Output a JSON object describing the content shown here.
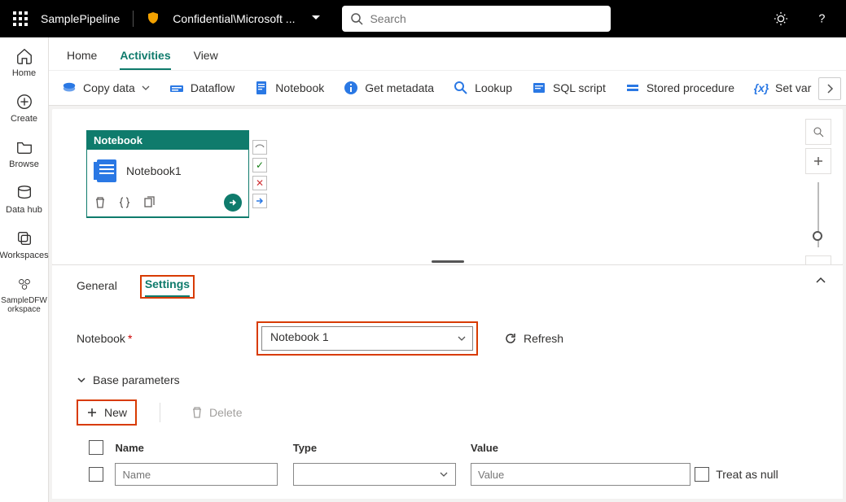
{
  "topbar": {
    "pipeline_name": "SamplePipeline",
    "sensitivity_prefix": "Confidential\\Microsoft ...",
    "search_placeholder": "Search"
  },
  "rail": {
    "home": "Home",
    "create": "Create",
    "browse": "Browse",
    "datahub": "Data hub",
    "workspaces": "Workspaces",
    "current_workspace": "SampleDFW\norkspace"
  },
  "main_tabs": {
    "home": "Home",
    "activities": "Activities",
    "view": "View"
  },
  "activities_toolbar": {
    "copy_data": "Copy data",
    "dataflow": "Dataflow",
    "notebook": "Notebook",
    "get_metadata": "Get metadata",
    "lookup": "Lookup",
    "sql_script": "SQL script",
    "stored_procedure": "Stored procedure",
    "set_var": "Set var"
  },
  "canvas": {
    "activity_type": "Notebook",
    "activity_name": "Notebook1"
  },
  "panel_tabs": {
    "general": "General",
    "settings": "Settings"
  },
  "settings": {
    "notebook_label": "Notebook",
    "notebook_value": "Notebook 1",
    "refresh": "Refresh",
    "base_parameters": "Base parameters",
    "new_btn": "New",
    "delete_btn": "Delete",
    "grid": {
      "headers": {
        "name": "Name",
        "type": "Type",
        "value": "Value",
        "null": "Treat as null"
      },
      "row": {
        "name_placeholder": "Name",
        "value_placeholder": "Value"
      }
    }
  }
}
